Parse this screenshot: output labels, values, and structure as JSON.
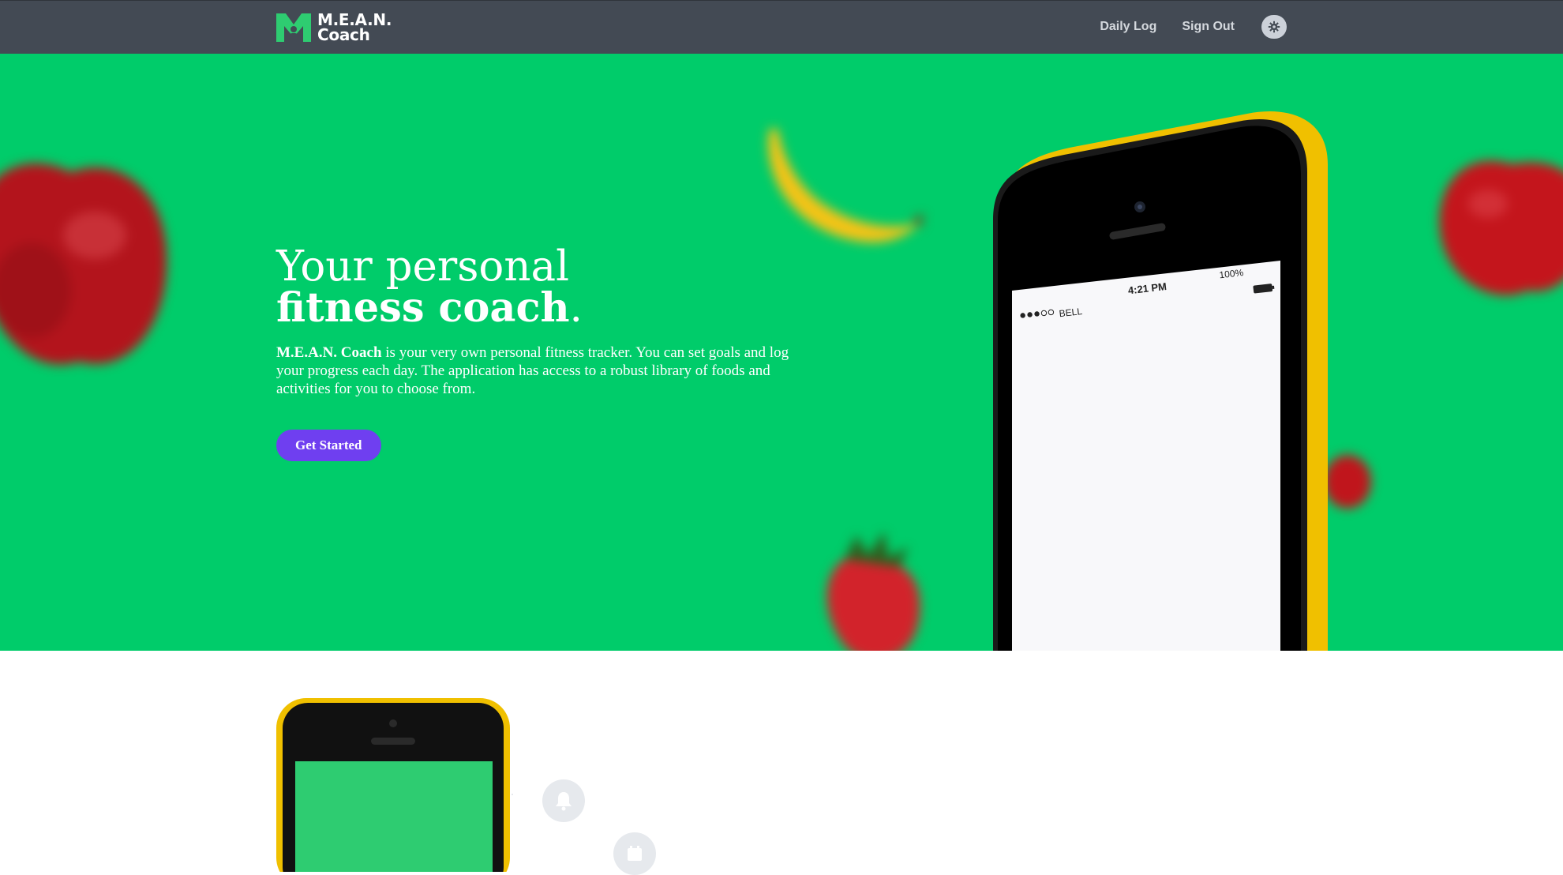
{
  "navbar": {
    "brand_line1": "M.E.A.N.",
    "brand_line2": "Coach",
    "links": [
      {
        "label": "Daily Log"
      },
      {
        "label": "Sign Out"
      }
    ],
    "settings_icon": "gear-icon"
  },
  "hero": {
    "headline_light": "Your personal",
    "headline_bold": "fitness coach",
    "headline_period": ".",
    "desc_bold": "M.E.A.N. Coach",
    "desc_rest": " is your very own personal fitness tracker. You can set goals and log your progress each day. The application has access to a robust library of foods and activities for you to choose from.",
    "cta_label": "Get Started",
    "phone_status": {
      "carrier": "BELL",
      "time": "4:21 PM",
      "battery": "100%"
    }
  },
  "features": {
    "icons": [
      "bell-icon",
      "calendar-icon"
    ]
  },
  "colors": {
    "navbar": "#434a54",
    "hero_green": "#00cc6a",
    "cta_purple": "#6f3ff0",
    "phone_yellow": "#f5c400",
    "screen_green": "#2ecc71"
  }
}
